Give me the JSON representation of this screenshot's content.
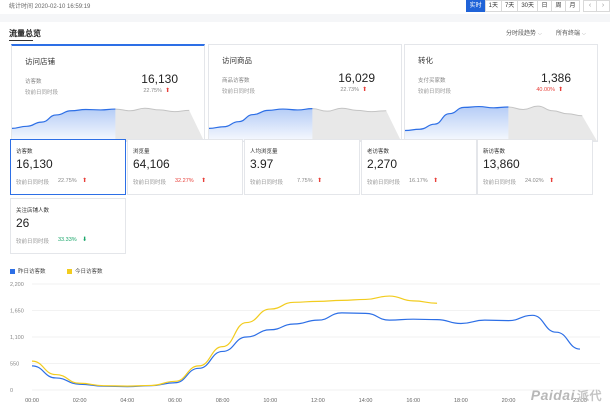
{
  "topbar": {
    "stat_time": "统计时间 2020-02-10 16:59:19",
    "ranges": [
      "实时",
      "1天",
      "7天",
      "30天",
      "日",
      "周",
      "月"
    ],
    "active_range": "实时",
    "prev": "‹",
    "next": "›"
  },
  "panel": {
    "title": "流量总览",
    "dropdown_terminal": "分时段趋势",
    "dropdown_channel": "所有终端"
  },
  "big_cards": [
    {
      "title": "访问店铺",
      "label": "访客数",
      "compare": "较前日同时段",
      "value": "16,130",
      "pct": "22.75%",
      "dir": "up",
      "pct_color": "gray"
    },
    {
      "title": "访问商品",
      "label": "商品访客数",
      "compare": "较前日同时段",
      "value": "16,029",
      "pct": "22.73%",
      "dir": "up",
      "pct_color": "gray"
    },
    {
      "title": "转化",
      "label": "支付买家数",
      "compare": "较前日同时段",
      "value": "1,386",
      "pct": "40.00%",
      "dir": "up",
      "pct_color": "red"
    }
  ],
  "small_cards": [
    {
      "label": "访客数",
      "value": "16,130",
      "compare": "较前日同时段",
      "pct": "22.75%",
      "dir": "up",
      "pct_color": "gray"
    },
    {
      "label": "浏览量",
      "value": "64,106",
      "compare": "较前日同时段",
      "pct": "32.27%",
      "dir": "up",
      "pct_color": "red"
    },
    {
      "label": "人均浏览量",
      "value": "3.97",
      "compare": "较前日同时段",
      "pct": "7.75%",
      "dir": "up",
      "pct_color": "gray"
    },
    {
      "label": "老访客数",
      "value": "2,270",
      "compare": "较前日同时段",
      "pct": "16.17%",
      "dir": "up",
      "pct_color": "gray"
    },
    {
      "label": "新访客数",
      "value": "13,860",
      "compare": "较前日同时段",
      "pct": "24.02%",
      "dir": "up",
      "pct_color": "gray"
    },
    {
      "label": "关注店铺人数",
      "value": "26",
      "compare": "较前日同时段",
      "pct": "33.33%",
      "dir": "down",
      "pct_color": "green"
    }
  ],
  "colors": {
    "blue": "#2d6fe6",
    "yellow": "#f2cc1f",
    "red": "#e8403a",
    "green": "#1aa66a"
  },
  "watermark": {
    "latin": "Paidai",
    "cn": "派代"
  },
  "chart_data": {
    "type": "line",
    "legend_position": "top-left",
    "grid": true,
    "x_ticks": [
      "00:00",
      "02:00",
      "04:00",
      "06:00",
      "08:00",
      "10:00",
      "12:00",
      "14:00",
      "16:00",
      "18:00",
      "20:00",
      "23:00"
    ],
    "y_ticks": [
      "0",
      "550",
      "1,100",
      "1,650",
      "2,200"
    ],
    "ylim": [
      0,
      2200
    ],
    "xlim": [
      0,
      23
    ],
    "series": [
      {
        "name": "昨日访客数",
        "color": "#2d6fe6",
        "x": [
          0,
          1,
          2,
          3,
          4,
          5,
          6,
          7,
          8,
          9,
          10,
          11,
          12,
          13,
          14,
          15,
          16,
          17,
          18,
          19,
          20,
          21,
          22,
          23
        ],
        "y": [
          500,
          250,
          120,
          80,
          70,
          90,
          150,
          450,
          800,
          1100,
          1250,
          1370,
          1450,
          1600,
          1590,
          1450,
          1470,
          1460,
          1380,
          1450,
          1440,
          1550,
          1200,
          850
        ]
      },
      {
        "name": "今日访客数",
        "color": "#f2cc1f",
        "x": [
          0,
          1,
          2,
          3,
          4,
          5,
          6,
          7,
          8,
          9,
          10,
          11,
          12,
          13,
          14,
          15,
          16,
          17
        ],
        "y": [
          600,
          320,
          140,
          90,
          80,
          95,
          180,
          500,
          900,
          1400,
          1680,
          1820,
          1840,
          1860,
          1880,
          1950,
          1850,
          1800
        ]
      }
    ]
  },
  "sparklines": [
    {
      "blue": [
        0.3,
        0.35,
        0.45,
        0.62,
        0.72,
        0.75,
        0.74,
        0.76
      ],
      "gray": [
        0.76,
        0.72,
        0.78,
        0.74,
        0.7,
        0.73
      ]
    },
    {
      "blue": [
        0.3,
        0.34,
        0.46,
        0.63,
        0.73,
        0.76,
        0.74,
        0.77
      ],
      "gray": [
        0.77,
        0.71,
        0.78,
        0.73,
        0.7,
        0.72
      ]
    },
    {
      "blue": [
        0.25,
        0.28,
        0.4,
        0.65,
        0.8,
        0.82,
        0.79,
        0.81
      ],
      "gray": [
        0.81,
        0.75,
        0.83,
        0.72,
        0.65,
        0.6
      ]
    }
  ]
}
